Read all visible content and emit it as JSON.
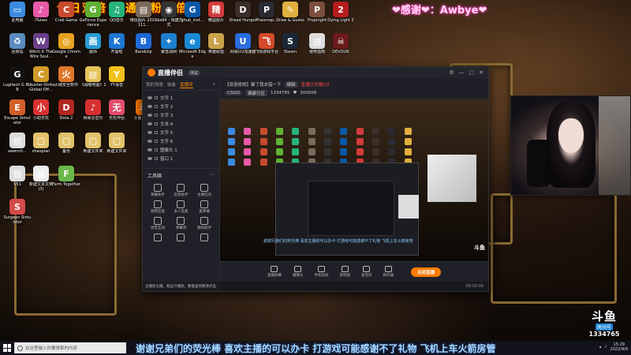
{
  "banner": {
    "left_text": "今日双倍   开通钻粉四倍！",
    "thanks_text": "❤感谢❤：Awbye❤"
  },
  "desktop_icons": [
    {
      "label": "此电脑",
      "glyph": "▭",
      "color": "#3c8be0"
    },
    {
      "label": "iTunes",
      "glyph": "♪",
      "color": "#e85aa8"
    },
    {
      "label": "Crab Game",
      "glyph": "C",
      "color": "#c84b2d"
    },
    {
      "label": "GeForce Experience",
      "glyph": "G",
      "color": "#5fb233"
    },
    {
      "label": "QQ音乐",
      "glyph": "♫",
      "color": "#26b37c"
    },
    {
      "label": "微信图片 2021111...",
      "glyph": "▤",
      "color": "#7a6a5a"
    },
    {
      "label": "obs64 - 快捷方式",
      "glyph": "◉",
      "color": "#333"
    },
    {
      "label": "ghub_inst...",
      "glyph": "G",
      "color": "#0a58a8"
    },
    {
      "label": "精益胶片",
      "glyph": "精",
      "color": "#d23b3b"
    },
    {
      "label": "Dread Hunger",
      "glyph": "D",
      "color": "#3a2e28"
    },
    {
      "label": "Phasmop...",
      "glyph": "P",
      "color": "#2a2a33"
    },
    {
      "label": "Draw & Guess",
      "glyph": "✎",
      "color": "#e0b040"
    },
    {
      "label": "Propnight",
      "glyph": "P",
      "color": "#7c4f3c"
    },
    {
      "label": "Dying Light 2",
      "glyph": "2",
      "color": "#b51c1c"
    },
    {
      "label": "回收站",
      "glyph": "♻",
      "color": "#5a8bbf"
    },
    {
      "label": "Witch It The Wire Soul...",
      "glyph": "W",
      "color": "#6b3f8a"
    },
    {
      "label": "Google Chrome",
      "glyph": "◎",
      "color": "#e8a323"
    },
    {
      "label": "画师",
      "glyph": "画",
      "color": "#2a9bd3"
    },
    {
      "label": "开黑啦",
      "glyph": "K",
      "color": "#1d76d1"
    },
    {
      "label": "Bandizip",
      "glyph": "B",
      "color": "#1f69d6"
    },
    {
      "label": "暴雪战网",
      "glyph": "✦",
      "color": "#1e7fcf"
    },
    {
      "label": "Microsoft Edge",
      "glyph": "e",
      "color": "#1a8ad4"
    },
    {
      "label": "英雄联盟",
      "glyph": "L",
      "color": "#c9a24a"
    },
    {
      "label": "网易UU加速器",
      "glyph": "U",
      "color": "#2a6de0"
    },
    {
      "label": "飞扬游戏平台",
      "glyph": "飞",
      "color": "#d24a2a"
    },
    {
      "label": "Steam",
      "glyph": "S",
      "color": "#1b2838"
    },
    {
      "label": "使用指南",
      "glyph": "▤",
      "color": "#ddd"
    },
    {
      "label": "DEVOUR",
      "glyph": "☠",
      "color": "#6a1a1a"
    },
    {
      "label": "Logitech G HUB",
      "glyph": "G",
      "color": "#111"
    },
    {
      "label": "Counter-Strike Global Off...",
      "glyph": "C",
      "color": "#d19a2a"
    },
    {
      "label": "火绒安全软件",
      "glyph": "火",
      "color": "#e0772a"
    },
    {
      "label": "《战略地图》1",
      "glyph": "▤",
      "color": "#e5c35a"
    },
    {
      "label": "YY语音",
      "glyph": "Y",
      "color": "#f3c21b"
    },
    {
      "label": "Escape Simulator",
      "glyph": "E",
      "color": "#d1602a"
    },
    {
      "label": "小助无忧",
      "glyph": "小",
      "color": "#d93232"
    },
    {
      "label": "Dota 2",
      "glyph": "D",
      "color": "#b0281f"
    },
    {
      "label": "网易云音乐",
      "glyph": "♪",
      "color": "#d62f2f"
    },
    {
      "label": "无忧伴侣",
      "glyph": "无",
      "color": "#e14b6b"
    },
    {
      "label": "斗鱼直播伴",
      "glyph": "斗",
      "color": "#ff7a00"
    },
    {
      "label": "awench...",
      "glyph": "▤",
      "color": "#ddd"
    },
    {
      "label": "zhaopian",
      "glyph": "▢",
      "color": "#e2c26a"
    },
    {
      "label": "备份",
      "glyph": "▢",
      "color": "#e2c26a"
    },
    {
      "label": "新建文件夹",
      "glyph": "▢",
      "color": "#e2c26a"
    },
    {
      "label": "新建文件夹",
      "glyph": "▢",
      "color": "#e2c26a"
    },
    {
      "label": "551",
      "glyph": "▤",
      "color": "#ddd"
    },
    {
      "label": "新建文本文档 (3)",
      "glyph": "▤",
      "color": "#eee"
    },
    {
      "label": "Farm Together",
      "glyph": "F",
      "color": "#6ab84a"
    },
    {
      "label": "Surgeon Simulator",
      "glyph": "S",
      "color": "#d44a4a"
    }
  ],
  "app": {
    "name": "直播伴侣",
    "version": "测试",
    "sidebar_tabs": [
      "我的场景",
      "装备",
      "直播间"
    ],
    "active_tab": "直播间",
    "scenes": [
      "文字 1",
      "文字 2",
      "文字 3",
      "文本 4",
      "文字 5",
      "文字 6",
      "图像头 1",
      "窗口 1"
    ],
    "tools_title": "工具箱",
    "tools": [
      "弹幕助手",
      "房管助手",
      "主播任务",
      "视频连麦",
      "多人连麦",
      "麦库播",
      "语音互动",
      "弹幕哥",
      "数码助手",
      "",
      "",
      ""
    ],
    "notice": "主播新主播，粉丝只播放，数据查询要请点击",
    "head": {
      "room_title": "【双倍修修】聚了我去猎一下",
      "tag1": "编辑",
      "live_status": "直播已开播0分",
      "category": "CSGO",
      "sub_tag": "偏僻分区",
      "viewers": "1334765",
      "likes": "300006"
    },
    "preview_ticker": "谢谢兄弟们的荧光棒 喜欢主播的可以办卡 打游戏可能感谢不了礼物  飞机上车火箭房管",
    "preview_logo": "斗鱼",
    "controls": [
      "直播屏幕",
      "摄像头",
      "手机投屏",
      "游戏窗",
      "麦克风",
      "扬声器"
    ],
    "go_live": "关闭直播",
    "status_time": "00:00:00"
  },
  "bottom_ticker": "谢谢兄弟们的荧光棒 喜欢主播的可以办卡 打游戏可能感谢不了礼物  飞机上车火箭房管",
  "douyu": {
    "brand": "斗鱼",
    "sub": "房间号",
    "room_number": "1334765"
  },
  "taskbar": {
    "search_placeholder": "在这里输入你要搜索的内容",
    "time": "15:29",
    "date": "2022/4/9"
  }
}
